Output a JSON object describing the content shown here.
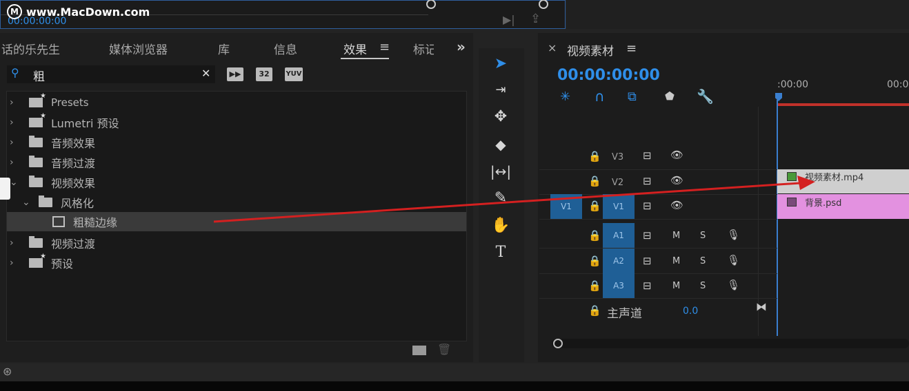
{
  "watermark": "www.MacDown.com",
  "top_preview": {
    "timecode": "00:00:00:00"
  },
  "effects_panel": {
    "tabs": [
      {
        "label": "话的乐先生"
      },
      {
        "label": "媒体浏览器"
      },
      {
        "label": "库"
      },
      {
        "label": "信息"
      },
      {
        "label": "效果",
        "active": true
      },
      {
        "label": "标记"
      }
    ],
    "more_tabs": "»",
    "search": {
      "value": "粗",
      "clear": "✕"
    },
    "filter_buttons": [
      "32",
      "YUV"
    ],
    "tree": [
      {
        "label": "Presets",
        "icon": "preset-folder-icon",
        "expanded": false
      },
      {
        "label": "Lumetri 预设",
        "icon": "preset-folder-icon",
        "expanded": false
      },
      {
        "label": "音频效果",
        "icon": "folder-icon",
        "expanded": false
      },
      {
        "label": "音频过渡",
        "icon": "folder-icon",
        "expanded": false
      },
      {
        "label": "视频效果",
        "icon": "folder-icon",
        "expanded": true
      },
      {
        "label": "风格化",
        "icon": "folder-icon",
        "expanded": true
      },
      {
        "label": "粗糙边缘",
        "icon": "effect-icon",
        "selected": true
      },
      {
        "label": "视频过渡",
        "icon": "folder-icon",
        "expanded": false
      },
      {
        "label": "预设",
        "icon": "preset-folder-icon",
        "expanded": false
      }
    ]
  },
  "timeline": {
    "title": "视频素材",
    "close": "×",
    "timecode": "00:00:00:00",
    "ruler_labels": [
      ":00:00",
      "00:0"
    ],
    "tracks": [
      {
        "id": "V3",
        "type": "video"
      },
      {
        "id": "V2",
        "type": "video",
        "clip": "视频素材.mp4"
      },
      {
        "id": "V1",
        "type": "video",
        "source": "V1",
        "clip": "背景.psd"
      },
      {
        "id": "A1",
        "type": "audio"
      },
      {
        "id": "A2",
        "type": "audio"
      },
      {
        "id": "A3",
        "type": "audio"
      }
    ],
    "audio_m": "M",
    "audio_s": "S",
    "master": {
      "label": "主声道",
      "value": "0.0"
    }
  },
  "colors": {
    "accent_blue": "#2f8ee8",
    "track_blue": "#1f5f96",
    "clip_v2": "#cfcfcf",
    "clip_v1": "#e391e0",
    "arrow_red": "#d42020",
    "playhead": "#3a7fd0"
  }
}
